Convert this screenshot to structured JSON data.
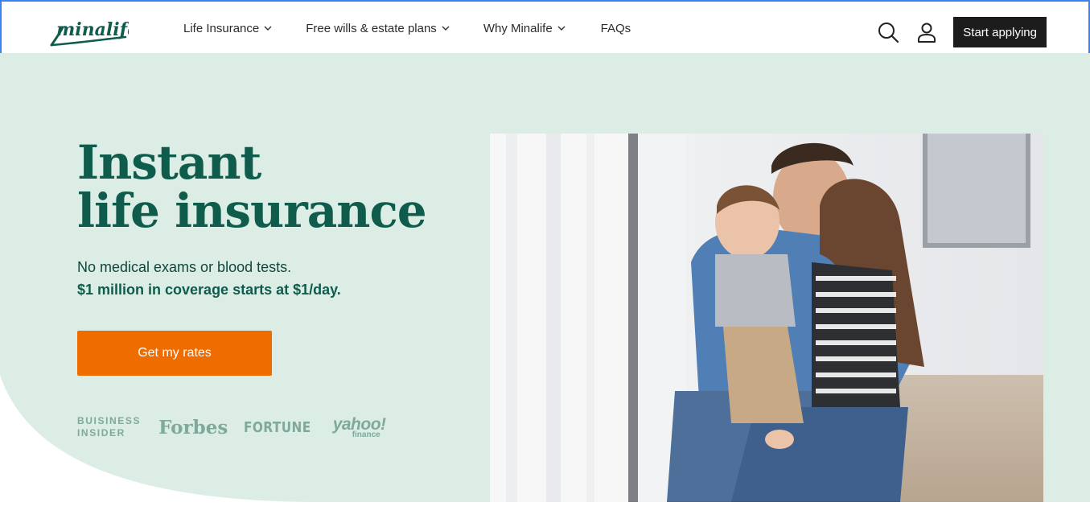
{
  "brand": {
    "name": "minalife"
  },
  "nav": {
    "items": [
      {
        "label": "Life Insurance",
        "has_dropdown": true
      },
      {
        "label": "Free wills & estate plans",
        "has_dropdown": true
      },
      {
        "label": "Why Minalife",
        "has_dropdown": true
      },
      {
        "label": "FAQs",
        "has_dropdown": false
      }
    ]
  },
  "header": {
    "search_icon": "search-icon",
    "account_icon": "user-icon",
    "cta_label": "Start applying"
  },
  "hero": {
    "title_line1": "Instant",
    "title_line2": "life insurance",
    "subtitle": "No medical exams or blood tests.",
    "highlight": "$1 million in coverage starts at $1/day.",
    "cta_label": "Get my rates"
  },
  "press": {
    "business_insider_line1": "BUISINESS",
    "business_insider_line2": "INSIDER",
    "forbes": "Forbes",
    "fortune": "FORTUNE",
    "yahoo": "yahoo!",
    "yahoo_sub": "finance"
  },
  "colors": {
    "accent_green": "#0f5c4d",
    "hero_bg": "#dbede5",
    "cta_orange": "#ef6c00",
    "dark_button": "#1c1c1c",
    "press_gray": "#7fa99b"
  }
}
